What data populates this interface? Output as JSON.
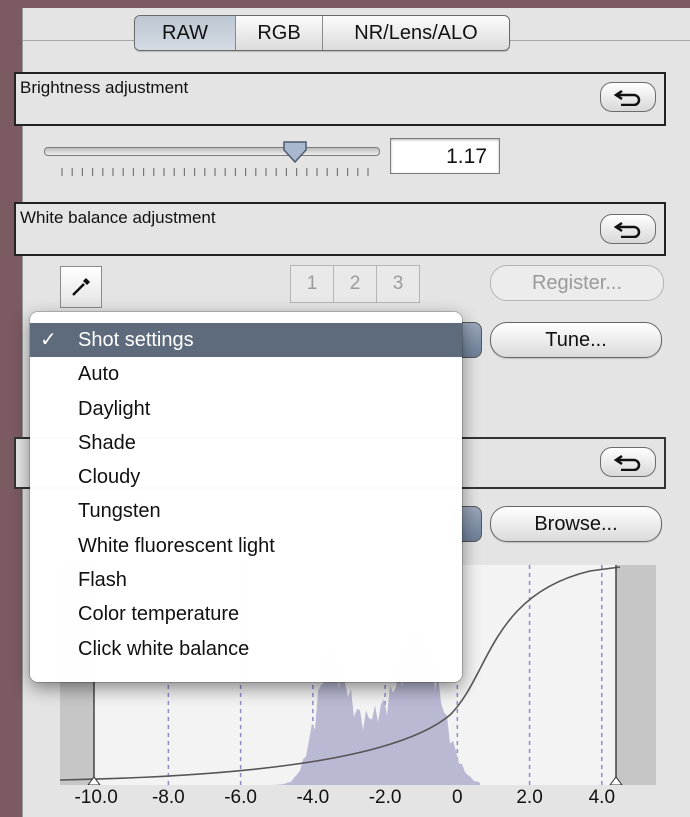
{
  "tabs": [
    {
      "label": "RAW",
      "active": true
    },
    {
      "label": "RGB",
      "active": false
    },
    {
      "label": "NR/Lens/ALO",
      "active": false
    }
  ],
  "brightness": {
    "title": "Brightness adjustment",
    "value": "1.17",
    "slider_fraction": 0.75
  },
  "white_balance": {
    "title": "White balance adjustment",
    "presets": [
      "1",
      "2",
      "3"
    ],
    "register_label": "Register...",
    "tune_label": "Tune..."
  },
  "picture_style": {
    "browse_label": "Browse..."
  },
  "menu": {
    "check_mark": "✓",
    "items": [
      {
        "label": "Shot settings",
        "selected": true
      },
      {
        "label": "Auto",
        "selected": false
      },
      {
        "label": "Daylight",
        "selected": false
      },
      {
        "label": "Shade",
        "selected": false
      },
      {
        "label": "Cloudy",
        "selected": false
      },
      {
        "label": "Tungsten",
        "selected": false
      },
      {
        "label": "White fluorescent light",
        "selected": false
      },
      {
        "label": "Flash",
        "selected": false
      },
      {
        "label": "Color temperature",
        "selected": false
      },
      {
        "label": "Click white balance",
        "selected": false
      }
    ]
  },
  "histogram": {
    "x_labels": [
      "-10.0",
      "-8.0",
      "-6.0",
      "-4.0",
      "-2.0",
      "0",
      "2.0",
      "4.0"
    ],
    "x_range": [
      -11,
      5.5
    ]
  },
  "icons": {
    "reset": "undo-arrow-icon",
    "eyedropper": "eyedropper-icon"
  },
  "colors": {
    "selected_menu": "#5e6b7c",
    "background": "#7b5a62",
    "histogram_fill": "#b9b9d4"
  }
}
